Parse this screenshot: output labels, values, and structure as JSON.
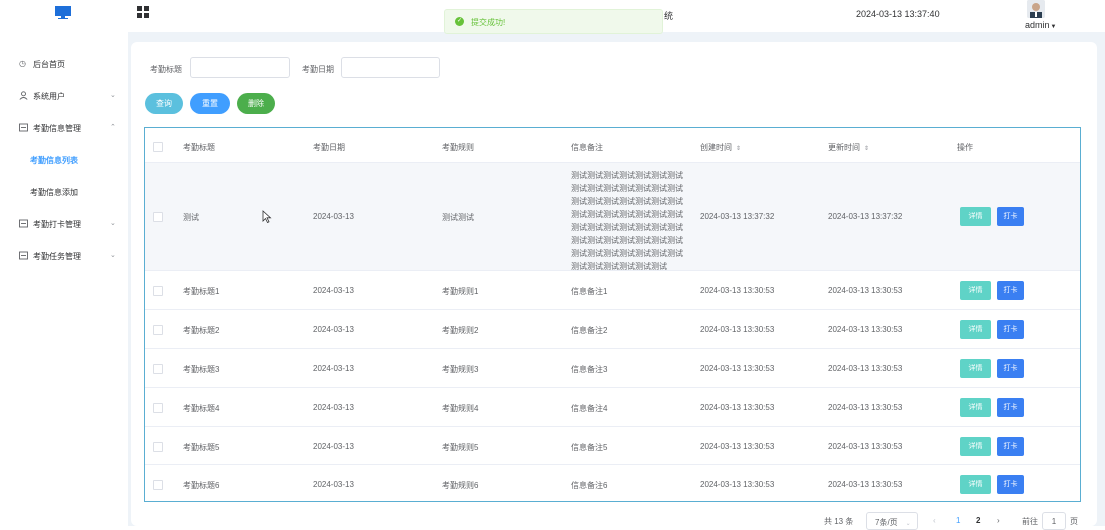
{
  "header": {
    "system_title_fragment": "统",
    "datetime": "2024-03-13 13:37:40",
    "user": "admin"
  },
  "toast": {
    "message": "提交成功!"
  },
  "sidebar": {
    "items": [
      {
        "label": "后台首页",
        "icon": "clock-icon"
      },
      {
        "label": "系统用户",
        "icon": "user-icon"
      },
      {
        "label": "考勤信息管理",
        "icon": "panel-icon"
      },
      {
        "label": "考勤信息列表",
        "active": true
      },
      {
        "label": "考勤信息添加"
      },
      {
        "label": "考勤打卡管理",
        "icon": "panel-icon"
      },
      {
        "label": "考勤任务管理",
        "icon": "panel-icon"
      }
    ]
  },
  "filters": {
    "title_label": "考勤标题",
    "date_label": "考勤日期",
    "title_value": "",
    "date_value": ""
  },
  "buttons": {
    "search": "查询",
    "reset": "重置",
    "delete": "删除"
  },
  "table": {
    "headers": [
      "考勤标题",
      "考勤日期",
      "考勤规则",
      "信息备注",
      "创建时间",
      "更新时间",
      "操作"
    ],
    "rows": [
      {
        "title": "测试",
        "date": "2024-03-13",
        "rule": "测试测试",
        "note": "测试测试测试测试测试测试测试测试测试测试测试测试测试测试测试测试测试测试测试测试测试测试测试测试测试测试测试测试测试测试测试测试测试测试测试测试测试测试测试测试测试测试测试测试测试测试测试测试测试测试测试测试测试测试测试",
        "created": "2024-03-13 13:37:32",
        "updated": "2024-03-13 13:37:32"
      },
      {
        "title": "考勤标题1",
        "date": "2024-03-13",
        "rule": "考勤规则1",
        "note": "信息备注1",
        "created": "2024-03-13 13:30:53",
        "updated": "2024-03-13 13:30:53"
      },
      {
        "title": "考勤标题2",
        "date": "2024-03-13",
        "rule": "考勤规则2",
        "note": "信息备注2",
        "created": "2024-03-13 13:30:53",
        "updated": "2024-03-13 13:30:53"
      },
      {
        "title": "考勤标题3",
        "date": "2024-03-13",
        "rule": "考勤规则3",
        "note": "信息备注3",
        "created": "2024-03-13 13:30:53",
        "updated": "2024-03-13 13:30:53"
      },
      {
        "title": "考勤标题4",
        "date": "2024-03-13",
        "rule": "考勤规则4",
        "note": "信息备注4",
        "created": "2024-03-13 13:30:53",
        "updated": "2024-03-13 13:30:53"
      },
      {
        "title": "考勤标题5",
        "date": "2024-03-13",
        "rule": "考勤规则5",
        "note": "信息备注5",
        "created": "2024-03-13 13:30:53",
        "updated": "2024-03-13 13:30:53"
      },
      {
        "title": "考勤标题6",
        "date": "2024-03-13",
        "rule": "考勤规则6",
        "note": "信息备注6",
        "created": "2024-03-13 13:30:53",
        "updated": "2024-03-13 13:30:53"
      }
    ],
    "action_detail": "详情",
    "action_punch": "打卡"
  },
  "pagination": {
    "total": "共 13 条",
    "page_size": "7条/页",
    "pages": [
      "1",
      "2"
    ],
    "current_page": "1",
    "goto_label": "前往",
    "goto_value": "1",
    "goto_suffix": "页"
  },
  "colors": {
    "accent": "#409eff",
    "success": "#67c23a",
    "table_border": "#5aaed2"
  }
}
